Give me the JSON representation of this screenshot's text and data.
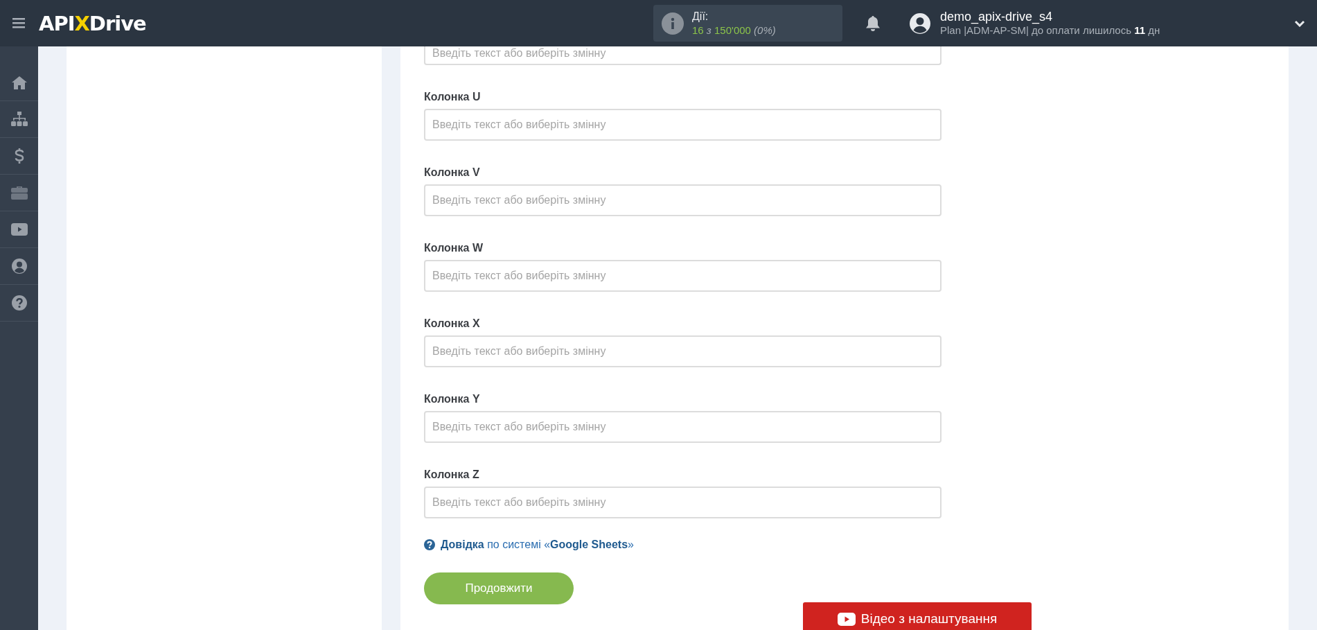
{
  "header": {
    "logo": {
      "left": "API",
      "mark": "X",
      "right": "Drive"
    },
    "actions": {
      "label": "Дії:",
      "used": "16",
      "of": "з",
      "total": "150'000",
      "percent": "(0%)"
    },
    "user": {
      "name": "demo_apix-drive_s4",
      "plan": "Plan |ADM-AP-SM| до оплати лишилось **11** дн"
    }
  },
  "fields": [
    {
      "placeholder": "Введіть текст або виберіть змінну"
    },
    {
      "label": "Колонка U",
      "placeholder": "Введіть текст або виберіть змінну"
    },
    {
      "label": "Колонка V",
      "placeholder": "Введіть текст або виберіть змінну"
    },
    {
      "label": "Колонка W",
      "placeholder": "Введіть текст або виберіть змінну"
    },
    {
      "label": "Колонка X",
      "placeholder": "Введіть текст або виберіть змінну"
    },
    {
      "label": "Колонка Y",
      "placeholder": "Введіть текст або виберіть змінну"
    },
    {
      "label": "Колонка Z",
      "placeholder": "Введіть текст або виберіть змінну"
    }
  ],
  "help_link": "**Довідка** по системі «**Google Sheets**»",
  "continue_button": "Продовжити",
  "video_button": "Відео з налаштування"
}
